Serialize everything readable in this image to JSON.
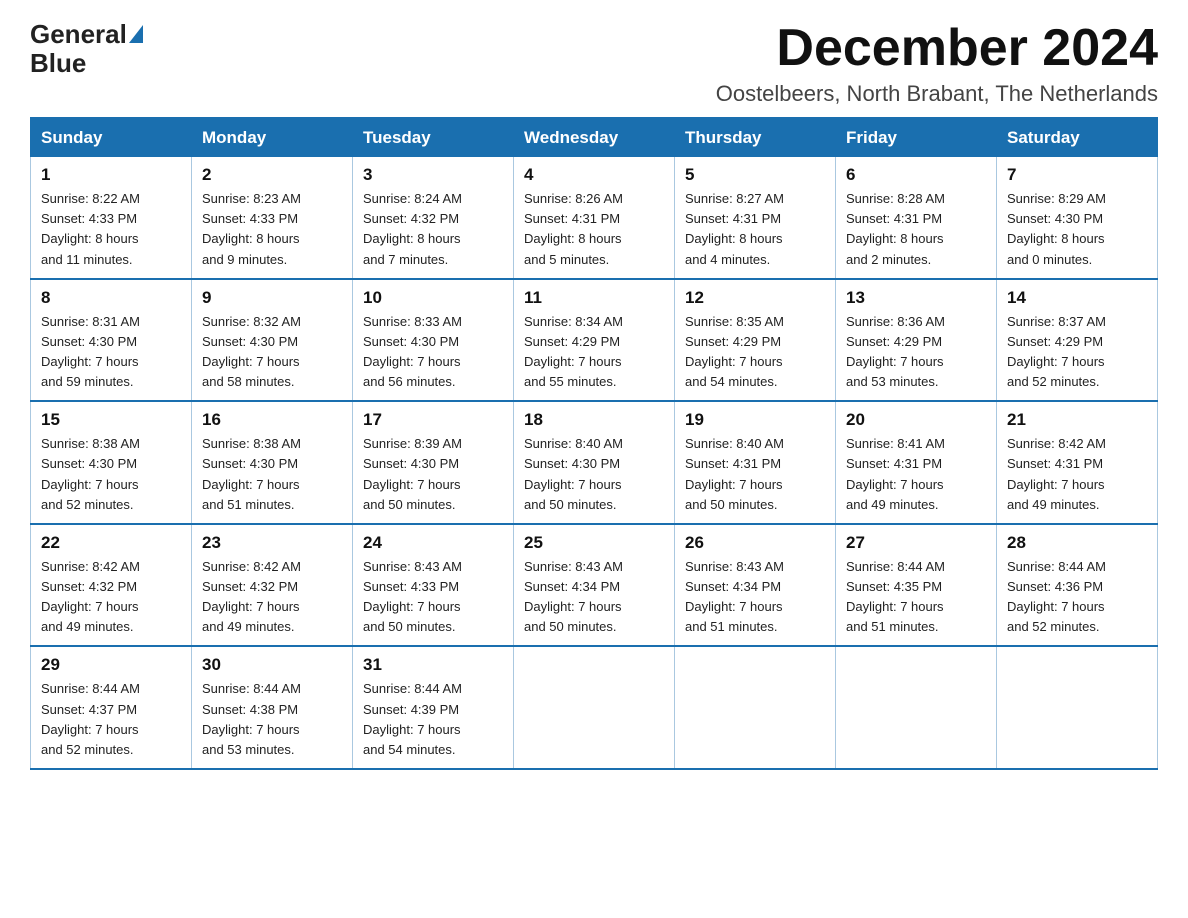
{
  "logo": {
    "text_general": "General",
    "text_blue": "Blue",
    "triangle_alt": "logo triangle"
  },
  "title": "December 2024",
  "location": "Oostelbeers, North Brabant, The Netherlands",
  "days_of_week": [
    "Sunday",
    "Monday",
    "Tuesday",
    "Wednesday",
    "Thursday",
    "Friday",
    "Saturday"
  ],
  "weeks": [
    [
      {
        "day": "1",
        "info": "Sunrise: 8:22 AM\nSunset: 4:33 PM\nDaylight: 8 hours\nand 11 minutes."
      },
      {
        "day": "2",
        "info": "Sunrise: 8:23 AM\nSunset: 4:33 PM\nDaylight: 8 hours\nand 9 minutes."
      },
      {
        "day": "3",
        "info": "Sunrise: 8:24 AM\nSunset: 4:32 PM\nDaylight: 8 hours\nand 7 minutes."
      },
      {
        "day": "4",
        "info": "Sunrise: 8:26 AM\nSunset: 4:31 PM\nDaylight: 8 hours\nand 5 minutes."
      },
      {
        "day": "5",
        "info": "Sunrise: 8:27 AM\nSunset: 4:31 PM\nDaylight: 8 hours\nand 4 minutes."
      },
      {
        "day": "6",
        "info": "Sunrise: 8:28 AM\nSunset: 4:31 PM\nDaylight: 8 hours\nand 2 minutes."
      },
      {
        "day": "7",
        "info": "Sunrise: 8:29 AM\nSunset: 4:30 PM\nDaylight: 8 hours\nand 0 minutes."
      }
    ],
    [
      {
        "day": "8",
        "info": "Sunrise: 8:31 AM\nSunset: 4:30 PM\nDaylight: 7 hours\nand 59 minutes."
      },
      {
        "day": "9",
        "info": "Sunrise: 8:32 AM\nSunset: 4:30 PM\nDaylight: 7 hours\nand 58 minutes."
      },
      {
        "day": "10",
        "info": "Sunrise: 8:33 AM\nSunset: 4:30 PM\nDaylight: 7 hours\nand 56 minutes."
      },
      {
        "day": "11",
        "info": "Sunrise: 8:34 AM\nSunset: 4:29 PM\nDaylight: 7 hours\nand 55 minutes."
      },
      {
        "day": "12",
        "info": "Sunrise: 8:35 AM\nSunset: 4:29 PM\nDaylight: 7 hours\nand 54 minutes."
      },
      {
        "day": "13",
        "info": "Sunrise: 8:36 AM\nSunset: 4:29 PM\nDaylight: 7 hours\nand 53 minutes."
      },
      {
        "day": "14",
        "info": "Sunrise: 8:37 AM\nSunset: 4:29 PM\nDaylight: 7 hours\nand 52 minutes."
      }
    ],
    [
      {
        "day": "15",
        "info": "Sunrise: 8:38 AM\nSunset: 4:30 PM\nDaylight: 7 hours\nand 52 minutes."
      },
      {
        "day": "16",
        "info": "Sunrise: 8:38 AM\nSunset: 4:30 PM\nDaylight: 7 hours\nand 51 minutes."
      },
      {
        "day": "17",
        "info": "Sunrise: 8:39 AM\nSunset: 4:30 PM\nDaylight: 7 hours\nand 50 minutes."
      },
      {
        "day": "18",
        "info": "Sunrise: 8:40 AM\nSunset: 4:30 PM\nDaylight: 7 hours\nand 50 minutes."
      },
      {
        "day": "19",
        "info": "Sunrise: 8:40 AM\nSunset: 4:31 PM\nDaylight: 7 hours\nand 50 minutes."
      },
      {
        "day": "20",
        "info": "Sunrise: 8:41 AM\nSunset: 4:31 PM\nDaylight: 7 hours\nand 49 minutes."
      },
      {
        "day": "21",
        "info": "Sunrise: 8:42 AM\nSunset: 4:31 PM\nDaylight: 7 hours\nand 49 minutes."
      }
    ],
    [
      {
        "day": "22",
        "info": "Sunrise: 8:42 AM\nSunset: 4:32 PM\nDaylight: 7 hours\nand 49 minutes."
      },
      {
        "day": "23",
        "info": "Sunrise: 8:42 AM\nSunset: 4:32 PM\nDaylight: 7 hours\nand 49 minutes."
      },
      {
        "day": "24",
        "info": "Sunrise: 8:43 AM\nSunset: 4:33 PM\nDaylight: 7 hours\nand 50 minutes."
      },
      {
        "day": "25",
        "info": "Sunrise: 8:43 AM\nSunset: 4:34 PM\nDaylight: 7 hours\nand 50 minutes."
      },
      {
        "day": "26",
        "info": "Sunrise: 8:43 AM\nSunset: 4:34 PM\nDaylight: 7 hours\nand 51 minutes."
      },
      {
        "day": "27",
        "info": "Sunrise: 8:44 AM\nSunset: 4:35 PM\nDaylight: 7 hours\nand 51 minutes."
      },
      {
        "day": "28",
        "info": "Sunrise: 8:44 AM\nSunset: 4:36 PM\nDaylight: 7 hours\nand 52 minutes."
      }
    ],
    [
      {
        "day": "29",
        "info": "Sunrise: 8:44 AM\nSunset: 4:37 PM\nDaylight: 7 hours\nand 52 minutes."
      },
      {
        "day": "30",
        "info": "Sunrise: 8:44 AM\nSunset: 4:38 PM\nDaylight: 7 hours\nand 53 minutes."
      },
      {
        "day": "31",
        "info": "Sunrise: 8:44 AM\nSunset: 4:39 PM\nDaylight: 7 hours\nand 54 minutes."
      },
      {
        "day": "",
        "info": ""
      },
      {
        "day": "",
        "info": ""
      },
      {
        "day": "",
        "info": ""
      },
      {
        "day": "",
        "info": ""
      }
    ]
  ]
}
